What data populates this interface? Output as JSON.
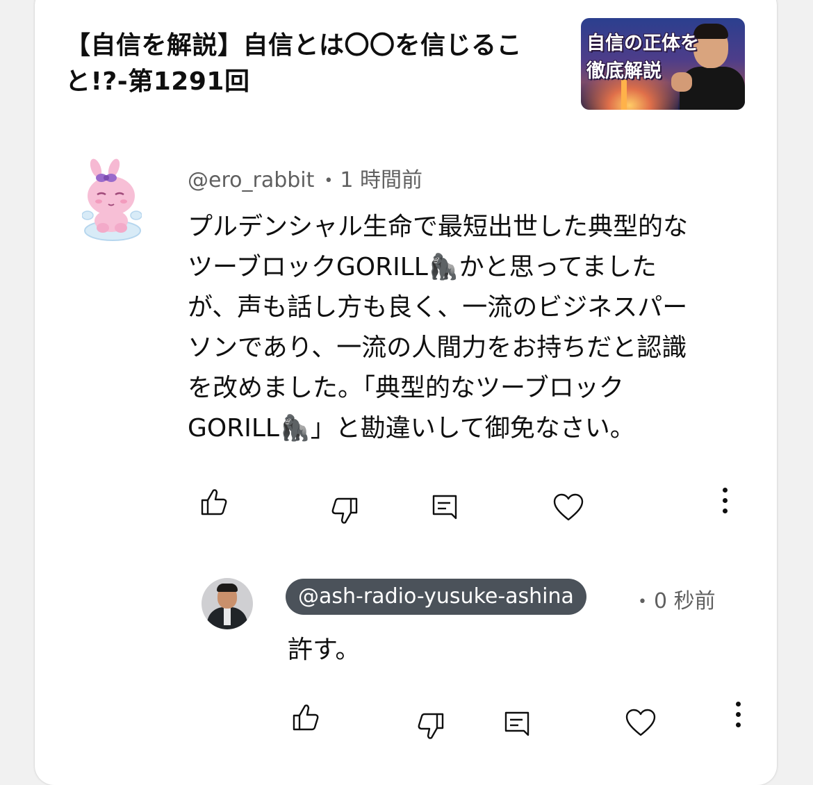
{
  "video": {
    "title_line1": "【自信を解説】自信とは〇〇を信じるこ",
    "title_line2": "と!?-第1291回",
    "thumbnail_text_line1": "自信の正体を",
    "thumbnail_text_line2": "徹底解説"
  },
  "comment": {
    "author": "@ero_rabbit",
    "time": "1 時間前",
    "lines": [
      "プルデンシャル生命で最短出世した典型的な",
      "ツーブロックGORILL🦍かと思ってました",
      "が、声も話し方も良く、一流のビジネスパー",
      "ソンであり、一流の人間力をお持ちだと認識",
      "を改めました。「典型的なツーブロック",
      "GORILL🦍」と勘違いして御免なさい。"
    ],
    "actions": {
      "like_icon": "thumbs-up-icon",
      "dislike_icon": "thumbs-down-icon",
      "reply_icon": "reply-comment-icon",
      "heart_icon": "heart-icon",
      "more_icon": "more-vertical-icon"
    }
  },
  "reply": {
    "author": "@ash-radio-yusuke-ashina",
    "time": "0 秒前",
    "text": "許す。"
  },
  "colors": {
    "text_primary": "#0f0f0f",
    "text_secondary": "#606060",
    "handle_pill": "#4b525a",
    "background": "#f1f1f1",
    "card": "#ffffff"
  }
}
